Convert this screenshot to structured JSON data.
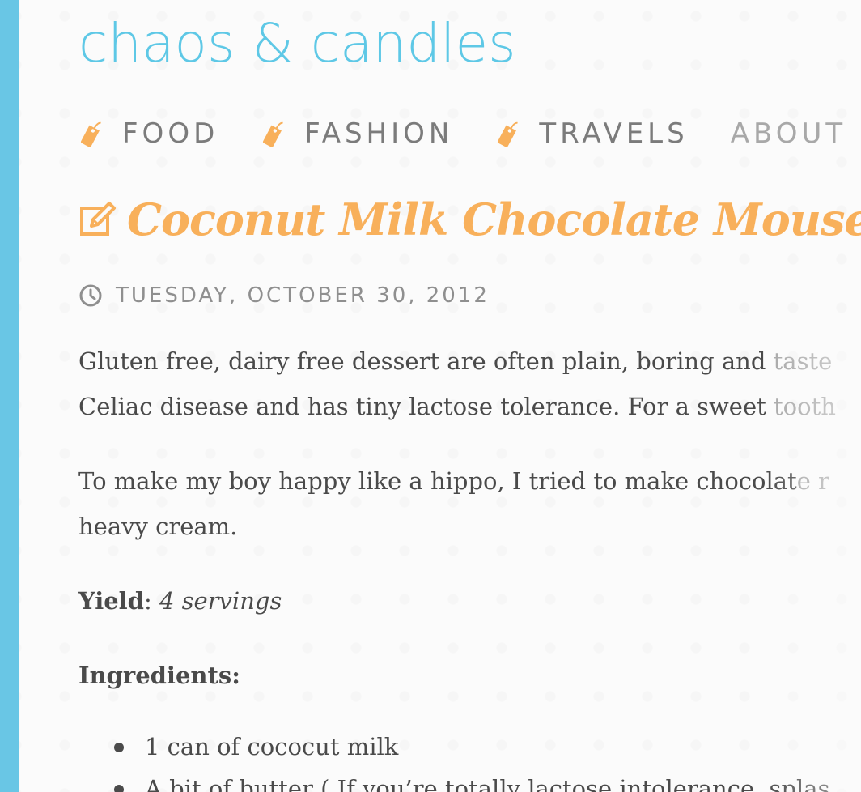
{
  "site": {
    "title": "chaos & candles",
    "accent_color": "#5ec8e6",
    "sidebar_color": "#69c6e5",
    "highlight_color": "#f8b05b"
  },
  "nav": {
    "items": [
      {
        "label": "FOOD",
        "icon": "tag-icon"
      },
      {
        "label": "FASHION",
        "icon": "tag-icon"
      },
      {
        "label": "TRAVELS",
        "icon": "tag-icon"
      },
      {
        "label": "ABOUT",
        "icon": ""
      }
    ]
  },
  "post": {
    "title": "Coconut Milk Chocolate Mouse",
    "title_icon": "edit-icon",
    "date": "TUESDAY, OCTOBER 30, 2012",
    "date_icon": "clock-icon",
    "paragraph1_line1_main": "Gluten free, dairy free dessert are often plain, boring and ",
    "paragraph1_line1_fade": "taste",
    "paragraph1_line2_main": "Celiac disease and has tiny lactose tolerance. For a sweet ",
    "paragraph1_line2_fade": "tooth",
    "paragraph2_line1_main": "To make my boy happy like a hippo, I tried to make chocolat",
    "paragraph2_line1_fade": "e r",
    "paragraph2_line2": "heavy cream.",
    "yield_label": "Yield",
    "yield_value": "4 servings",
    "ingredients_heading": "Ingredients:",
    "ingredients": [
      "1 can of cococut milk",
      "A bit of butter ( If you’re totally lactose intolerance, splas"
    ]
  }
}
